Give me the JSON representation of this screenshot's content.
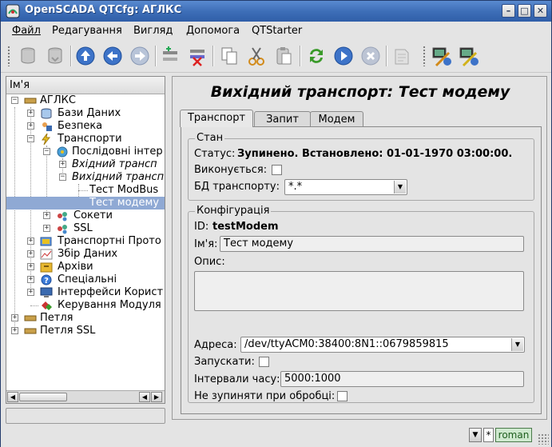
{
  "window": {
    "title": "OpenSCADA QTCfg: АГЛКС",
    "controls": [
      "minimize",
      "maximize",
      "close"
    ]
  },
  "menu": [
    {
      "label": "Файл"
    },
    {
      "label": "Редагування"
    },
    {
      "label": "Вигляд"
    },
    {
      "label": "Допомога"
    },
    {
      "label": "QTStarter"
    }
  ],
  "toolbar": {
    "icons": [
      "db-load-icon",
      "db-save-icon",
      "up-icon",
      "back-icon",
      "forward-icon",
      "add-item-icon",
      "delete-item-icon",
      "copy-icon",
      "cut-icon",
      "paste-icon",
      "refresh-icon",
      "start-icon",
      "stop-icon",
      "info-icon",
      "connect-station-icon",
      "disconnect-station-icon"
    ]
  },
  "tree": {
    "header": "Ім'я",
    "items": [
      {
        "label": "АГЛКС",
        "italic": false
      },
      {
        "label": "Бази Даних",
        "italic": false
      },
      {
        "label": "Безпека",
        "italic": false
      },
      {
        "label": "Транспорти",
        "italic": false
      },
      {
        "label": "Послідовні інтер",
        "italic": false
      },
      {
        "label": "Вхідний трансп",
        "italic": true
      },
      {
        "label": "Вихідний трансп",
        "italic": true
      },
      {
        "label": "Тест ModBus",
        "italic": false
      },
      {
        "label": "Тест модему",
        "italic": false
      },
      {
        "label": "Сокети",
        "italic": false
      },
      {
        "label": "SSL",
        "italic": false
      },
      {
        "label": "Транспортні Прото",
        "italic": false
      },
      {
        "label": "Збір Даних",
        "italic": false
      },
      {
        "label": "Архіви",
        "italic": false
      },
      {
        "label": "Спеціальні",
        "italic": false
      },
      {
        "label": "Інтерфейси Корист",
        "italic": false
      },
      {
        "label": "Керування Модуля",
        "italic": false
      },
      {
        "label": "Петля",
        "italic": false
      },
      {
        "label": "Петля SSL",
        "italic": false
      }
    ]
  },
  "page": {
    "title": "Вихідний транспорт: Тест модему",
    "tabs": [
      {
        "label": "Транспорт"
      },
      {
        "label": "Запит"
      },
      {
        "label": "Модем"
      }
    ],
    "state": {
      "title": "Стан",
      "status_label": "Статус:",
      "status_value": "Зупинено. Встановлено: 01-01-1970 03:00:00.",
      "running_label": "Виконується:",
      "db_label": "БД транспорту:",
      "db_value": "*.*"
    },
    "config": {
      "title": "Конфігурація",
      "id_label": "ID:",
      "id_value": "testModem",
      "name_label": "Ім'я:",
      "name_value": "Тест модему",
      "descr_label": "Опис:",
      "descr_value": "",
      "address_label": "Адреса:",
      "address_value": "/dev/ttyACM0:38400:8N1::0679859815",
      "start_label": "Запускати:",
      "timings_label": "Інтервали часу:",
      "timings_value": "5000:1000",
      "nohold_label": "Не зупиняти при обробці:"
    }
  },
  "statusbar": {
    "modified": "*",
    "user": "roman"
  },
  "colors": {
    "titlebar": "#3e6fb8",
    "selection": "#8fa9d4",
    "user_badge": "#cfe9cf"
  }
}
